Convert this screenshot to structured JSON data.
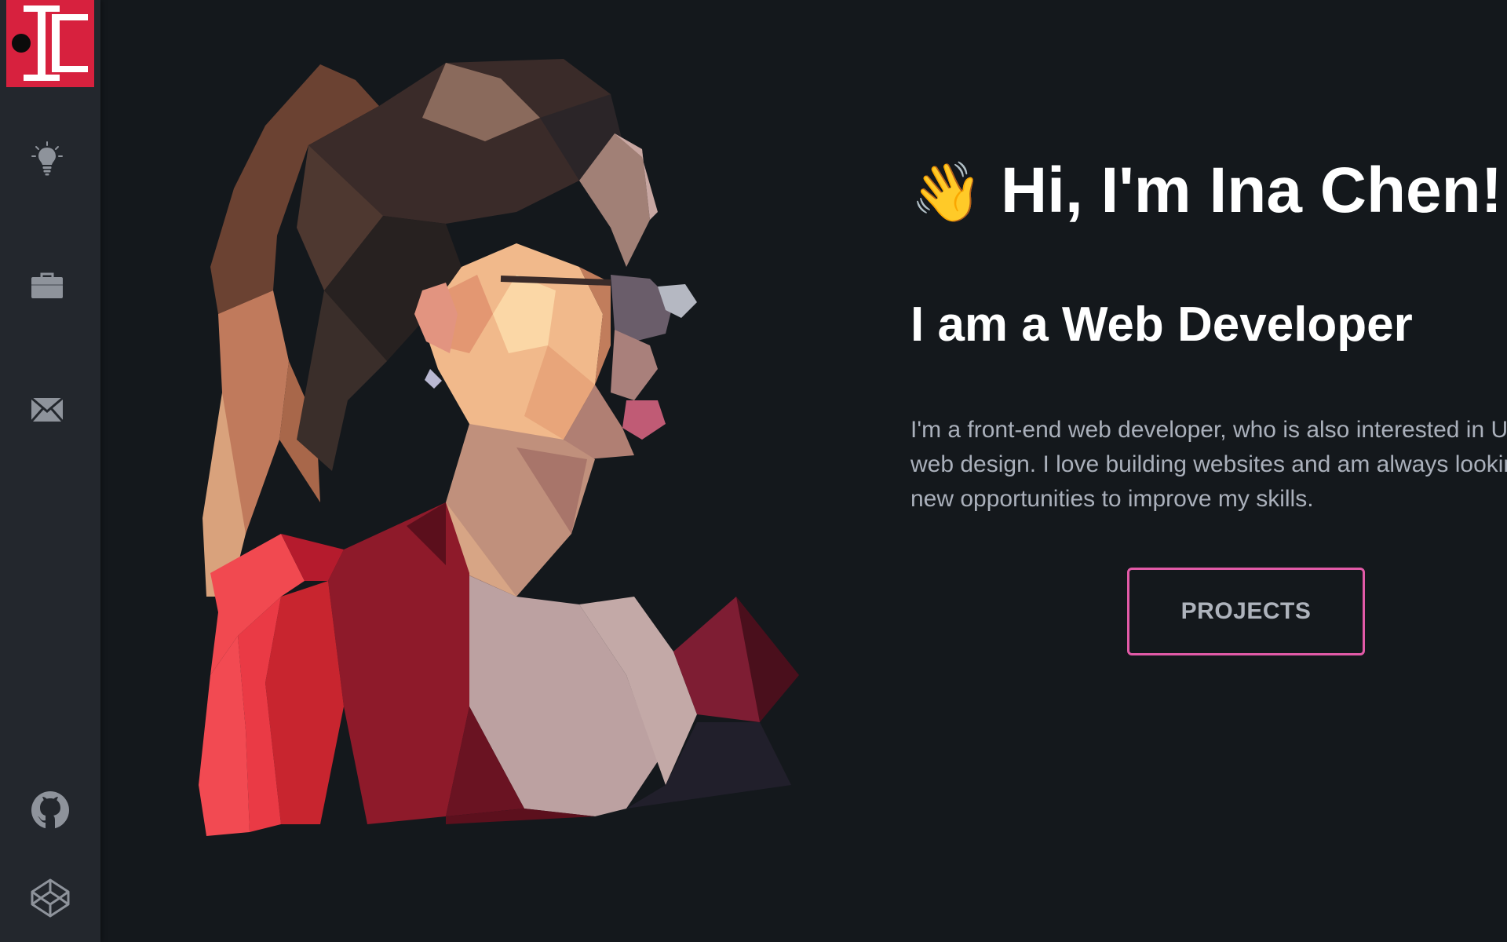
{
  "brand": {
    "logo_letters": "IC",
    "logo_color": "#d7213e"
  },
  "sidebar": {
    "nav": [
      {
        "icon": "lightbulb-icon",
        "label": "skills"
      },
      {
        "icon": "briefcase-icon",
        "label": "work"
      },
      {
        "icon": "envelope-icon",
        "label": "contact"
      }
    ],
    "social": [
      {
        "icon": "github-icon"
      },
      {
        "icon": "codepen-icon"
      }
    ]
  },
  "hero": {
    "wave_emoji": "👋",
    "greeting": "Hi, I'm Ina Chen!",
    "role": "I am a Web Developer",
    "bio": "I'm a front-end web developer, who is also interested in UI/UX web design. I love building websites and am always looking for new opportunities to improve my skills.",
    "cta_label": "PROJECTS",
    "cta_border_color": "#e25aa7"
  },
  "colors": {
    "background": "#14181c",
    "sidebar": "#23272d",
    "heading": "#ffffff",
    "body_text": "#aab0bb"
  }
}
